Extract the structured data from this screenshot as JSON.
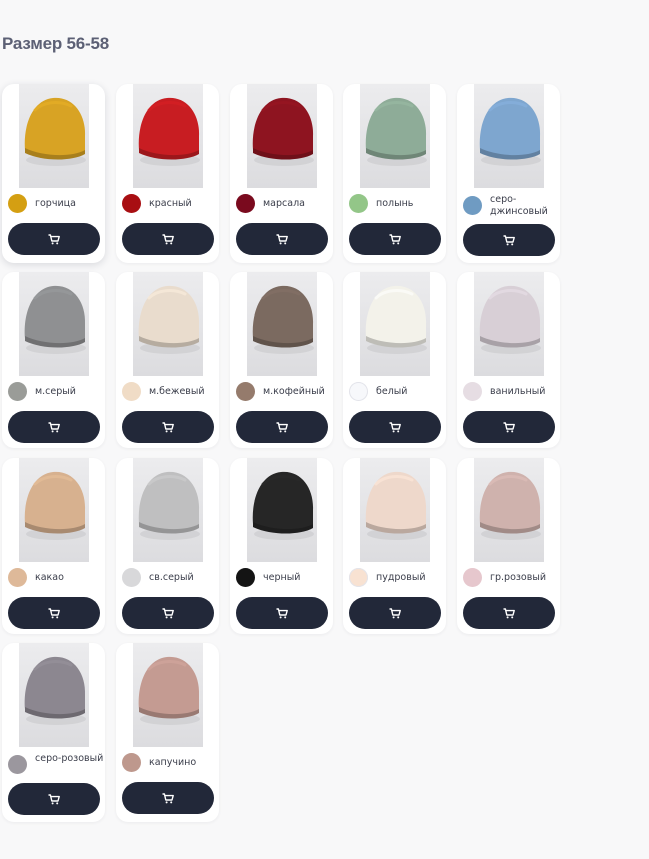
{
  "section": {
    "title": "Размер 56-58"
  },
  "icons": {
    "cart": "cart-icon"
  },
  "colors": {
    "button_bg": "#222839",
    "page_bg": "#f8f8f9",
    "title": "#5c6075"
  },
  "products": [
    {
      "label": "горчица",
      "swatch": "#d49f12",
      "hat": "#d8a324"
    },
    {
      "label": "красный",
      "swatch": "#a80e12",
      "hat": "#c81d22"
    },
    {
      "label": "марсала",
      "swatch": "#7a0a1e",
      "hat": "#8e1420"
    },
    {
      "label": "полынь",
      "swatch": "#93c688",
      "hat": "#8eac98"
    },
    {
      "label": "серо-джинсовый",
      "swatch": "#6f9bc2",
      "hat": "#7ea6cf"
    },
    {
      "label": "м.серый",
      "swatch": "#9a9c98",
      "hat": "#8f9092"
    },
    {
      "label": "м.бежевый",
      "swatch": "#f0dcc6",
      "hat": "#e9dccd"
    },
    {
      "label": "м.кофейный",
      "swatch": "#957b6c",
      "hat": "#7b6a60"
    },
    {
      "label": "белый",
      "swatch": "#f7f8fb",
      "hat": "#f3f2ea"
    },
    {
      "label": "ванильный",
      "swatch": "#e6dde3",
      "hat": "#d8cfd6"
    },
    {
      "label": "какао",
      "swatch": "#deb999",
      "hat": "#d7b18f"
    },
    {
      "label": "св.серый",
      "swatch": "#d8d8da",
      "hat": "#bfbfc0"
    },
    {
      "label": "черный",
      "swatch": "#141414",
      "hat": "#262626"
    },
    {
      "label": "пудровый",
      "swatch": "#f8e2d2",
      "hat": "#eed8cb"
    },
    {
      "label": "гр.розовый",
      "swatch": "#e6c7cd",
      "hat": "#cfb2ad"
    },
    {
      "label": "серо-розовый",
      "swatch": "#9b979e",
      "hat": "#8c8790"
    },
    {
      "label": "капучино",
      "swatch": "#be988d",
      "hat": "#c49b92"
    }
  ]
}
